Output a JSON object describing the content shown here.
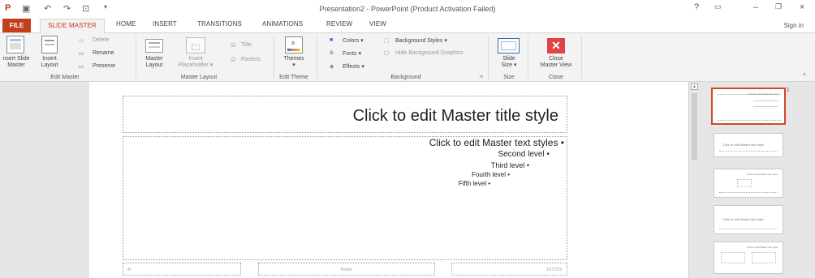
{
  "window": {
    "title": "Presentation2 - PowerPoint (Product Activation Failed)",
    "controls": [
      "?",
      "–",
      "×"
    ]
  },
  "tabs": {
    "file": "FILE",
    "items": [
      "SLIDE MASTER",
      "HOME",
      "INSERT",
      "TRANSITIONS",
      "ANIMATIONS",
      "REVIEW",
      "VIEW"
    ],
    "active": "SLIDE MASTER",
    "sign_in": "Sign in"
  },
  "ribbon": {
    "edit_master": {
      "group_label": "Edit Master",
      "insert_slide_master": [
        "nsert Slide",
        "Master"
      ],
      "insert_layout": [
        "Insert",
        "Layout"
      ],
      "delete": "Delete",
      "rename": "Rename",
      "preserve": "Preserve"
    },
    "master_layout": {
      "group_label": "Master Layout",
      "master_layout": [
        "Master",
        "Layout"
      ],
      "insert_placeholder": [
        "Insert",
        "Placeholder"
      ],
      "title": "Title",
      "footers": "Footers"
    },
    "edit_theme": {
      "group_label": "Edit Theme",
      "themes": "Themes"
    },
    "background": {
      "group_label": "Background",
      "colors": "Colors",
      "fonts": "Fonts",
      "effects": "Effects",
      "background_styles": "Background Styles",
      "hide_background_graphics": "Hide Background Graphics"
    },
    "size": {
      "group_label": "Size",
      "slide_size": [
        "Slide",
        "Size"
      ]
    },
    "close": {
      "group_label": "Close",
      "close_master_view": [
        "Close",
        "Master View"
      ]
    }
  },
  "slide": {
    "title": "Click to edit Master title style",
    "levels": [
      "Click to edit Master text styles •",
      "Second level •",
      "Third level •",
      "Fourth level •",
      "Fifth level •"
    ],
    "footer_left": "‹#›",
    "footer_center": "Footer",
    "footer_right": "11/17/19"
  },
  "thumbnails": {
    "selected_number": "1",
    "title_text": "Click to edit Master title style",
    "layout_title": "Click to edit Master title style"
  },
  "colors": {
    "accent": "#c43e1c",
    "selection": "#d24726",
    "close_red": "#e04343"
  }
}
